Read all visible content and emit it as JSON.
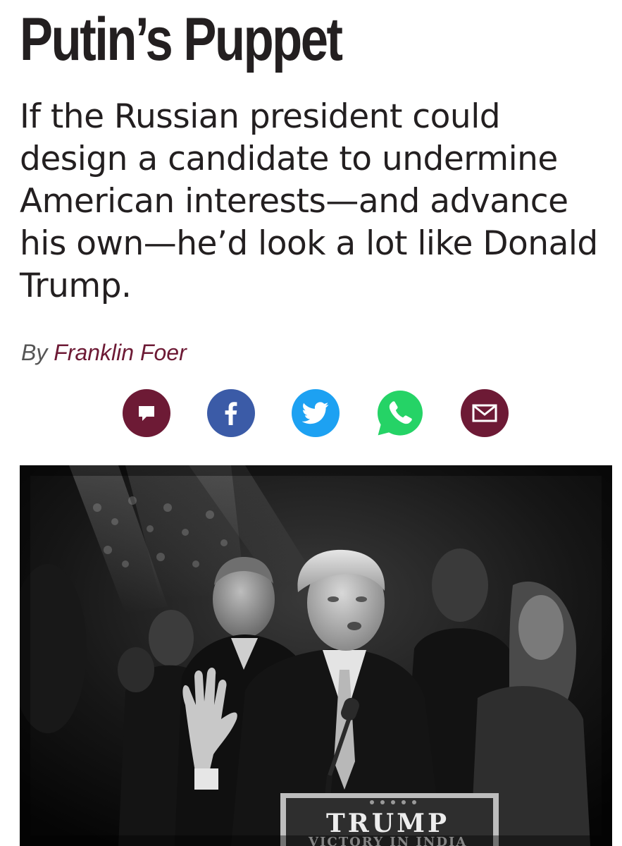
{
  "article": {
    "headline": "Putin’s Puppet",
    "dek": "If the Russian president could design a candidate to undermine American interests—and advance his own—he’d look a lot like Donald Trump.",
    "byline": {
      "prefix": "By ",
      "author": "Franklin Foer"
    }
  },
  "share": {
    "buttons": [
      {
        "icon": "comment-icon",
        "color": "#6d1a35"
      },
      {
        "icon": "facebook-icon",
        "color": "#3b5ba7"
      },
      {
        "icon": "twitter-icon",
        "color": "#1da1f2"
      },
      {
        "icon": "whatsapp-icon",
        "color": "#25d366"
      },
      {
        "icon": "email-icon",
        "color": "#6d1a35"
      }
    ]
  },
  "hero_image": {
    "sign_text": "TRUMP",
    "sign_subtext": "VICTORY IN INDIA"
  }
}
